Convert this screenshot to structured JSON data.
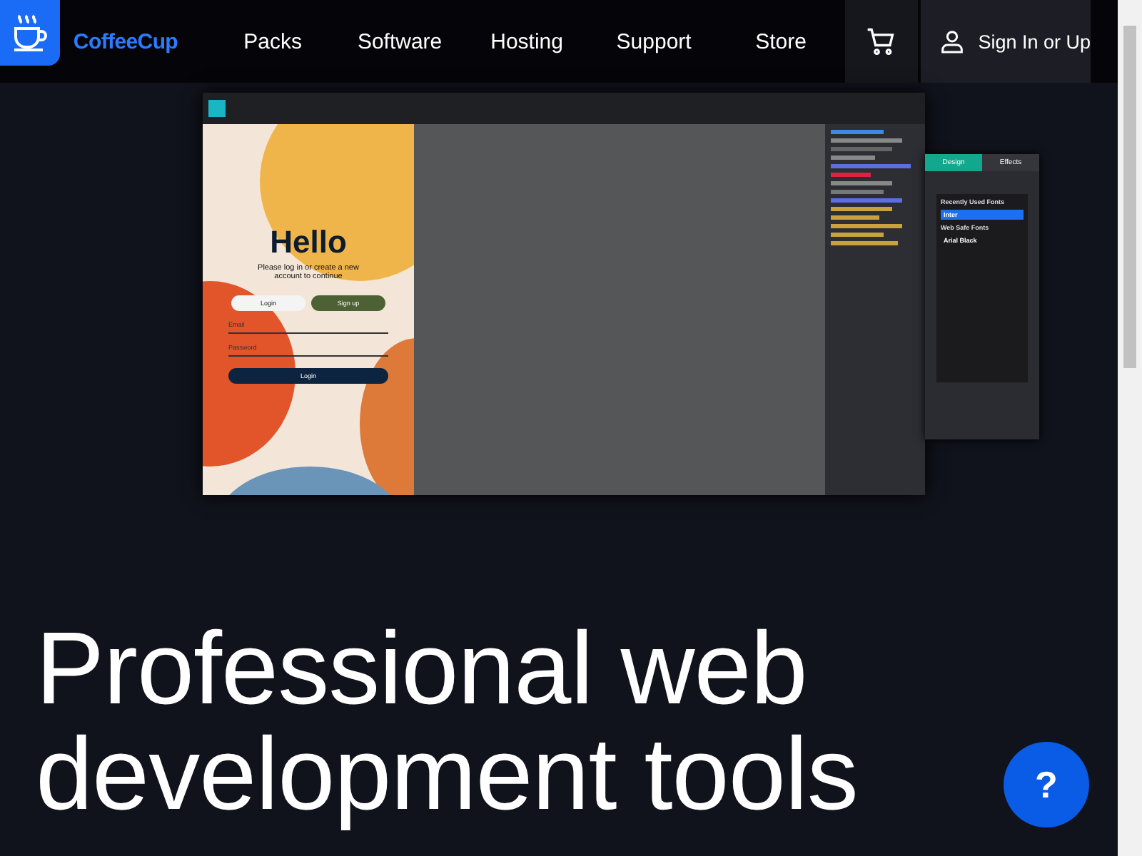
{
  "header": {
    "brand": "CoffeeCup",
    "nav": [
      {
        "label": "Packs"
      },
      {
        "label": "Software"
      },
      {
        "label": "Hosting"
      },
      {
        "label": "Support"
      },
      {
        "label": "Store"
      }
    ],
    "sign_in": "Sign In or Up"
  },
  "app_preview": {
    "title": "Hello",
    "subtitle": "Please log in or create a new account to continue",
    "tabs": [
      {
        "label": "Login",
        "selected": true
      },
      {
        "label": "Sign up",
        "selected": false
      }
    ],
    "fields": [
      {
        "placeholder": "Email"
      },
      {
        "placeholder": "Password"
      }
    ],
    "submit": "Login",
    "panel_tabs": [
      {
        "label": "Design",
        "selected": true
      },
      {
        "label": "Effects",
        "selected": false
      }
    ],
    "font_groups": [
      {
        "heading": "Recently Used Fonts",
        "fonts": [
          {
            "name": "Inter",
            "selected": true
          }
        ]
      },
      {
        "heading": "Web Safe Fonts",
        "fonts": [
          {
            "name": "Arial Black",
            "selected": false
          }
        ]
      }
    ]
  },
  "hero": {
    "lines": [
      "Professional web",
      "development tools"
    ]
  },
  "help_button": "?"
}
